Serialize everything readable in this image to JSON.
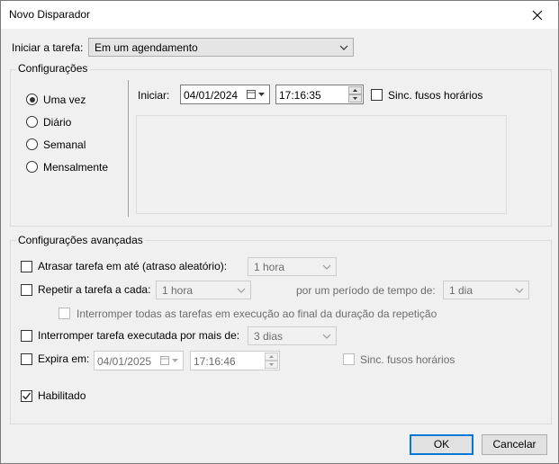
{
  "window": {
    "title": "Novo Disparador"
  },
  "trigger": {
    "label": "Iniciar a tarefa:",
    "value": "Em um agendamento"
  },
  "settings": {
    "group_label": "Configurações",
    "schedule_options": [
      "Uma vez",
      "Diário",
      "Semanal",
      "Mensalmente"
    ],
    "selected_option": "Uma vez",
    "start_label": "Iniciar:",
    "start_date": "04/01/2024",
    "start_time": "17:16:35",
    "sync_label": "Sinc. fusos horários"
  },
  "advanced": {
    "group_label": "Configurações avançadas",
    "delay_label": "Atrasar tarefa em até (atraso aleatório):",
    "delay_value": "1 hora",
    "repeat_label": "Repetir a tarefa a cada:",
    "repeat_value": "1 hora",
    "repeat_duration_label": "por um período de tempo de:",
    "repeat_duration_value": "1 dia",
    "stop_all_label": "Interromper todas as tarefas em execução ao final da duração da repetição",
    "stop_longer_label": "Interromper tarefa executada por mais de:",
    "stop_longer_value": "3 dias",
    "expire_label": "Expira em:",
    "expire_date": "04/01/2025",
    "expire_time": "17:16:46",
    "expire_sync_label": "Sinc. fusos horários",
    "enabled_label": "Habilitado",
    "enabled_checked": true
  },
  "buttons": {
    "ok": "OK",
    "cancel": "Cancelar"
  },
  "icons": {
    "close": "close-icon",
    "calendar": "calendar-icon",
    "dropdown": "chevron-down-icon",
    "check": "checkmark-icon"
  },
  "colors": {
    "accent": "#0078d7",
    "background": "#f0f0f0"
  }
}
